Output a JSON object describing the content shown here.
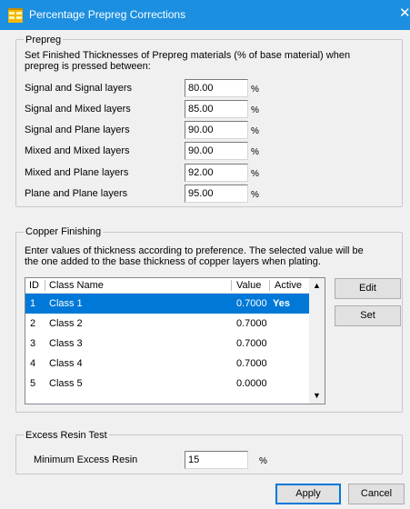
{
  "window": {
    "title": "Percentage Prepreg Corrections",
    "icon": "table-app-icon",
    "close_glyph": "✕"
  },
  "prepreg": {
    "legend": "Prepreg",
    "description_line1": "Set Finished Thicknesses of Prepreg materials  (% of base material) when",
    "description_line2": "prepreg is pressed between:",
    "unit": "%",
    "rows": [
      {
        "label": "Signal and Signal layers",
        "value": "80.00"
      },
      {
        "label": "Signal and Mixed layers",
        "value": "85.00"
      },
      {
        "label": "Signal and Plane layers",
        "value": "90.00"
      },
      {
        "label": "Mixed and Mixed layers",
        "value": "90.00"
      },
      {
        "label": "Mixed and Plane layers",
        "value": "92.00"
      },
      {
        "label": "Plane and Plane layers",
        "value": "95.00"
      }
    ]
  },
  "copper": {
    "legend": "Copper Finishing",
    "description_line1": "Enter values of thickness according to preference. The selected value will be",
    "description_line2": "the one added to the base thickness of copper layers when plating.",
    "columns": {
      "id": "ID",
      "name": "Class Name",
      "value": "Value",
      "active": "Active"
    },
    "rows": [
      {
        "id": "1",
        "name": "Class 1",
        "value": "0.7000",
        "active": "Yes"
      },
      {
        "id": "2",
        "name": "Class 2",
        "value": "0.7000",
        "active": ""
      },
      {
        "id": "3",
        "name": "Class 3",
        "value": "0.7000",
        "active": ""
      },
      {
        "id": "4",
        "name": "Class 4",
        "value": "0.7000",
        "active": ""
      },
      {
        "id": "5",
        "name": "Class 5",
        "value": "0.0000",
        "active": ""
      }
    ],
    "selected_row": 1,
    "edit_label": "Edit",
    "set_label": "Set"
  },
  "resin": {
    "legend": "Excess Resin Test",
    "label": "Minimum Excess Resin",
    "value": "15",
    "unit": "%"
  },
  "footer": {
    "apply_label": "Apply",
    "cancel_label": "Cancel"
  },
  "colors": {
    "titlebar": "#1c8fe0",
    "selection": "#0078d7",
    "window_bg": "#f0f0f0"
  }
}
